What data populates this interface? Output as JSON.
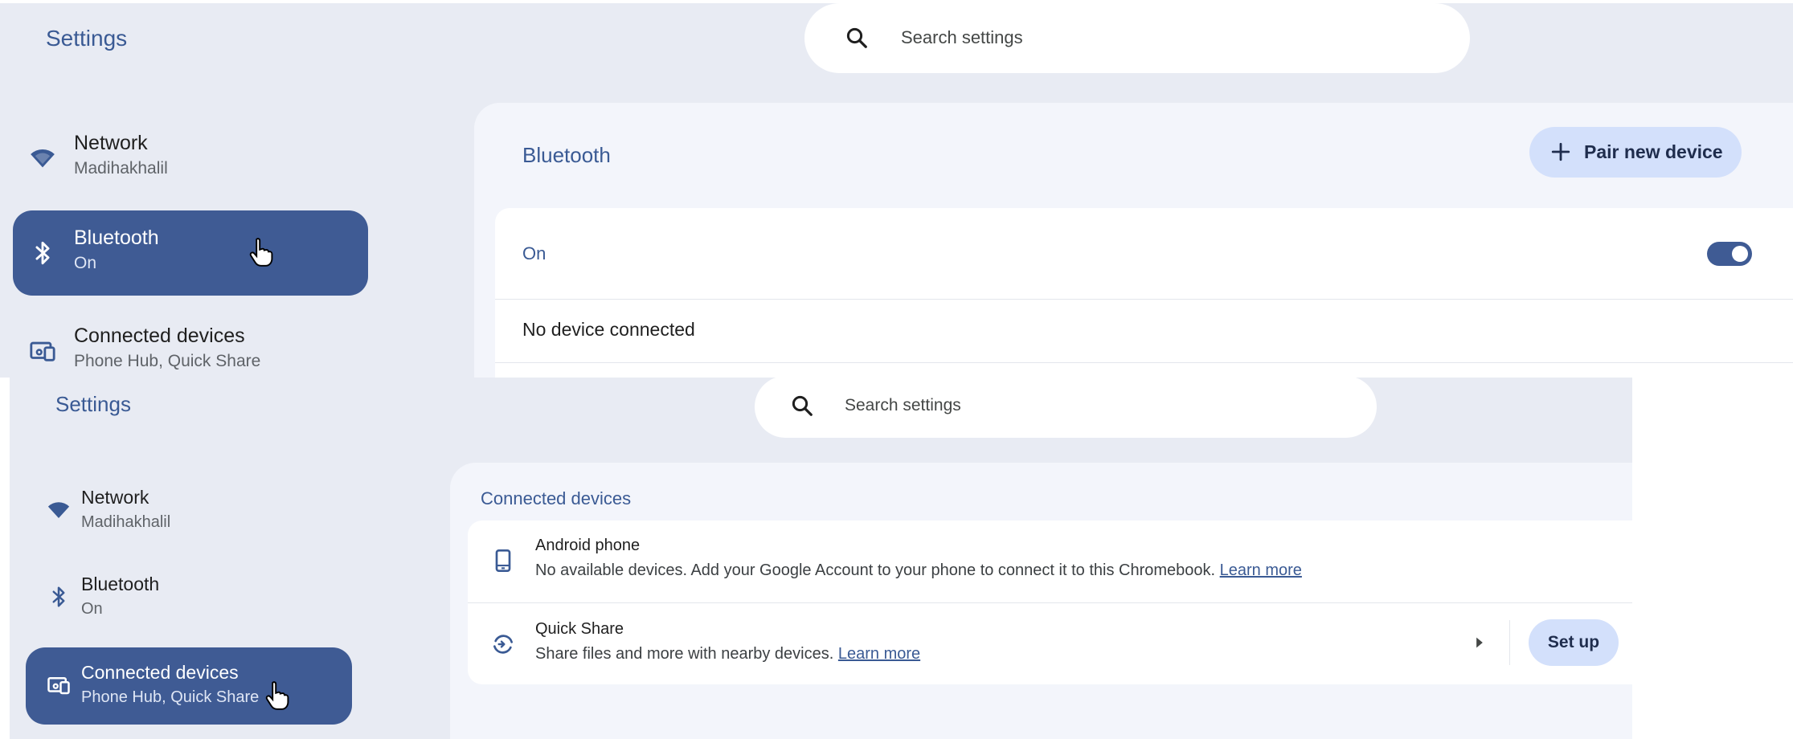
{
  "top": {
    "app_title": "Settings",
    "search_placeholder": "Search settings",
    "nav": [
      {
        "title": "Network",
        "sub": "Madihakhalil",
        "icon": "wifi-icon"
      },
      {
        "title": "Bluetooth",
        "sub": "On",
        "icon": "bluetooth-icon",
        "active": true
      },
      {
        "title": "Connected devices",
        "sub": "Phone Hub, Quick Share",
        "icon": "connected-devices-icon"
      }
    ],
    "section_title": "Bluetooth",
    "pair_button": "Pair new device",
    "bluetooth_state_label": "On",
    "bluetooth_enabled": true,
    "no_device_text": "No device connected"
  },
  "bottom": {
    "app_title": "Settings",
    "search_placeholder": "Search settings",
    "nav": [
      {
        "title": "Network",
        "sub": "Madihakhalil",
        "icon": "wifi-icon"
      },
      {
        "title": "Bluetooth",
        "sub": "On",
        "icon": "bluetooth-icon"
      },
      {
        "title": "Connected devices",
        "sub": "Phone Hub, Quick Share",
        "icon": "connected-devices-icon",
        "active": true
      }
    ],
    "section_title": "Connected devices",
    "android": {
      "title": "Android phone",
      "desc": "No available devices. Add your Google Account to your phone to connect it to this Chromebook.",
      "link": "Learn more"
    },
    "quick_share": {
      "title": "Quick Share",
      "desc": "Share files and more with nearby devices.",
      "link": "Learn more",
      "button": "Set up"
    }
  },
  "colors": {
    "accent": "#3f5b94",
    "panel_bg": "#e8ebf3",
    "button_bg": "#d3e0fb"
  }
}
